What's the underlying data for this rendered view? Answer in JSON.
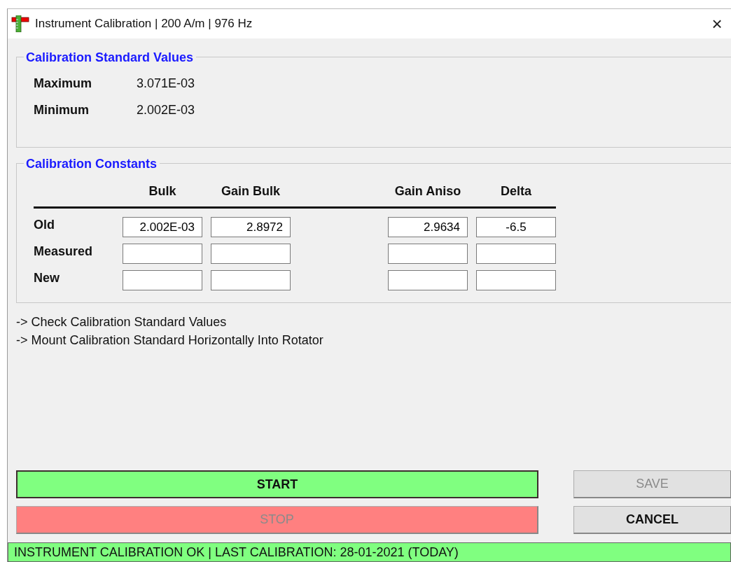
{
  "window": {
    "title": "Instrument Calibration | 200 A/m | 976 Hz",
    "close": "×"
  },
  "standard_values": {
    "title": "Calibration  Standard Values",
    "rows": [
      {
        "label": "Maximum",
        "value": "3.071E-03"
      },
      {
        "label": "Minimum",
        "value": "2.002E-03"
      }
    ]
  },
  "constants": {
    "title": "Calibration Constants",
    "columns": [
      "Bulk",
      "Gain Bulk",
      "Gain Aniso",
      "Delta"
    ],
    "rows": [
      {
        "label": "Old",
        "values": [
          "2.002E-03",
          "2.8972",
          "2.9634",
          "-6.5"
        ]
      },
      {
        "label": "Measured"
      },
      {
        "label": "New"
      }
    ]
  },
  "instructions": [
    "-> Check Calibration Standard Values",
    "-> Mount Calibration Standard Horizontally Into Rotator"
  ],
  "buttons": [
    {
      "label": "START",
      "color": "#80ff80",
      "disabled": false,
      "focused": true
    },
    {
      "label": "SAVE",
      "disabled": true,
      "focused": false
    },
    {
      "label": "STOP",
      "color": "#ff8080",
      "disabled": true,
      "focused": false
    },
    {
      "label": "CANCEL",
      "disabled": false,
      "focused": false
    }
  ],
  "status_bar": {
    "text": "INSTRUMENT CALIBRATION OK | LAST CALIBRATION: 28-01-2021 (TODAY)",
    "color": "#80ff80"
  }
}
